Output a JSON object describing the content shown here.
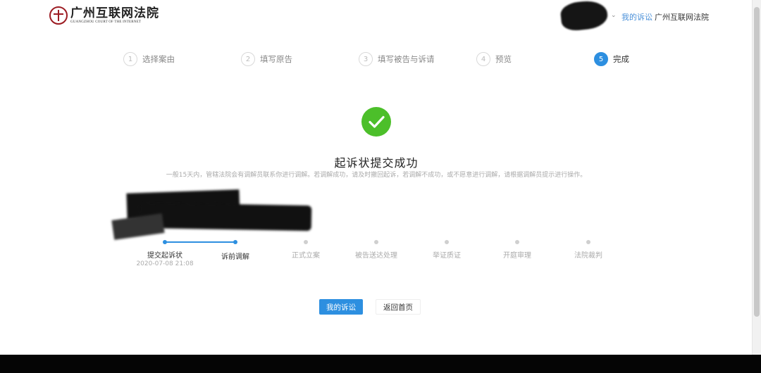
{
  "header": {
    "logo_name": "广州互联网法院",
    "logo_sub": "GUANGZHOU COURT OF THE INTERNET",
    "nav_my_cases": "我的诉讼",
    "nav_court": "广州互联网法院"
  },
  "steps": [
    {
      "num": "1",
      "label": "选择案由"
    },
    {
      "num": "2",
      "label": "填写原告"
    },
    {
      "num": "3",
      "label": "填写被告与诉请"
    },
    {
      "num": "4",
      "label": "预览"
    },
    {
      "num": "5",
      "label": "完成"
    }
  ],
  "success": {
    "title": "起诉状提交成功",
    "description": "一般15天内，管辖法院会有调解员联系你进行调解。若调解成功，请及时撤回起诉，若调解不成功，或不愿意进行调解，请根据调解员提示进行操作。"
  },
  "progress": [
    {
      "label": "提交起诉状",
      "time": "2020-07-08 21:08",
      "status": "done"
    },
    {
      "label": "诉前调解",
      "time": "",
      "status": "current"
    },
    {
      "label": "正式立案",
      "time": "",
      "status": "pending"
    },
    {
      "label": "被告送达处理",
      "time": "",
      "status": "pending"
    },
    {
      "label": "举证质证",
      "time": "",
      "status": "pending"
    },
    {
      "label": "开庭审理",
      "time": "",
      "status": "pending"
    },
    {
      "label": "法院裁判",
      "time": "",
      "status": "pending"
    }
  ],
  "buttons": {
    "my_cases": "我的诉讼",
    "back_home": "返回首页"
  },
  "colors": {
    "primary": "#2d8fe0",
    "success": "#4cbf2a",
    "muted": "#aaaaaa",
    "logo_red": "#9c1b22"
  }
}
